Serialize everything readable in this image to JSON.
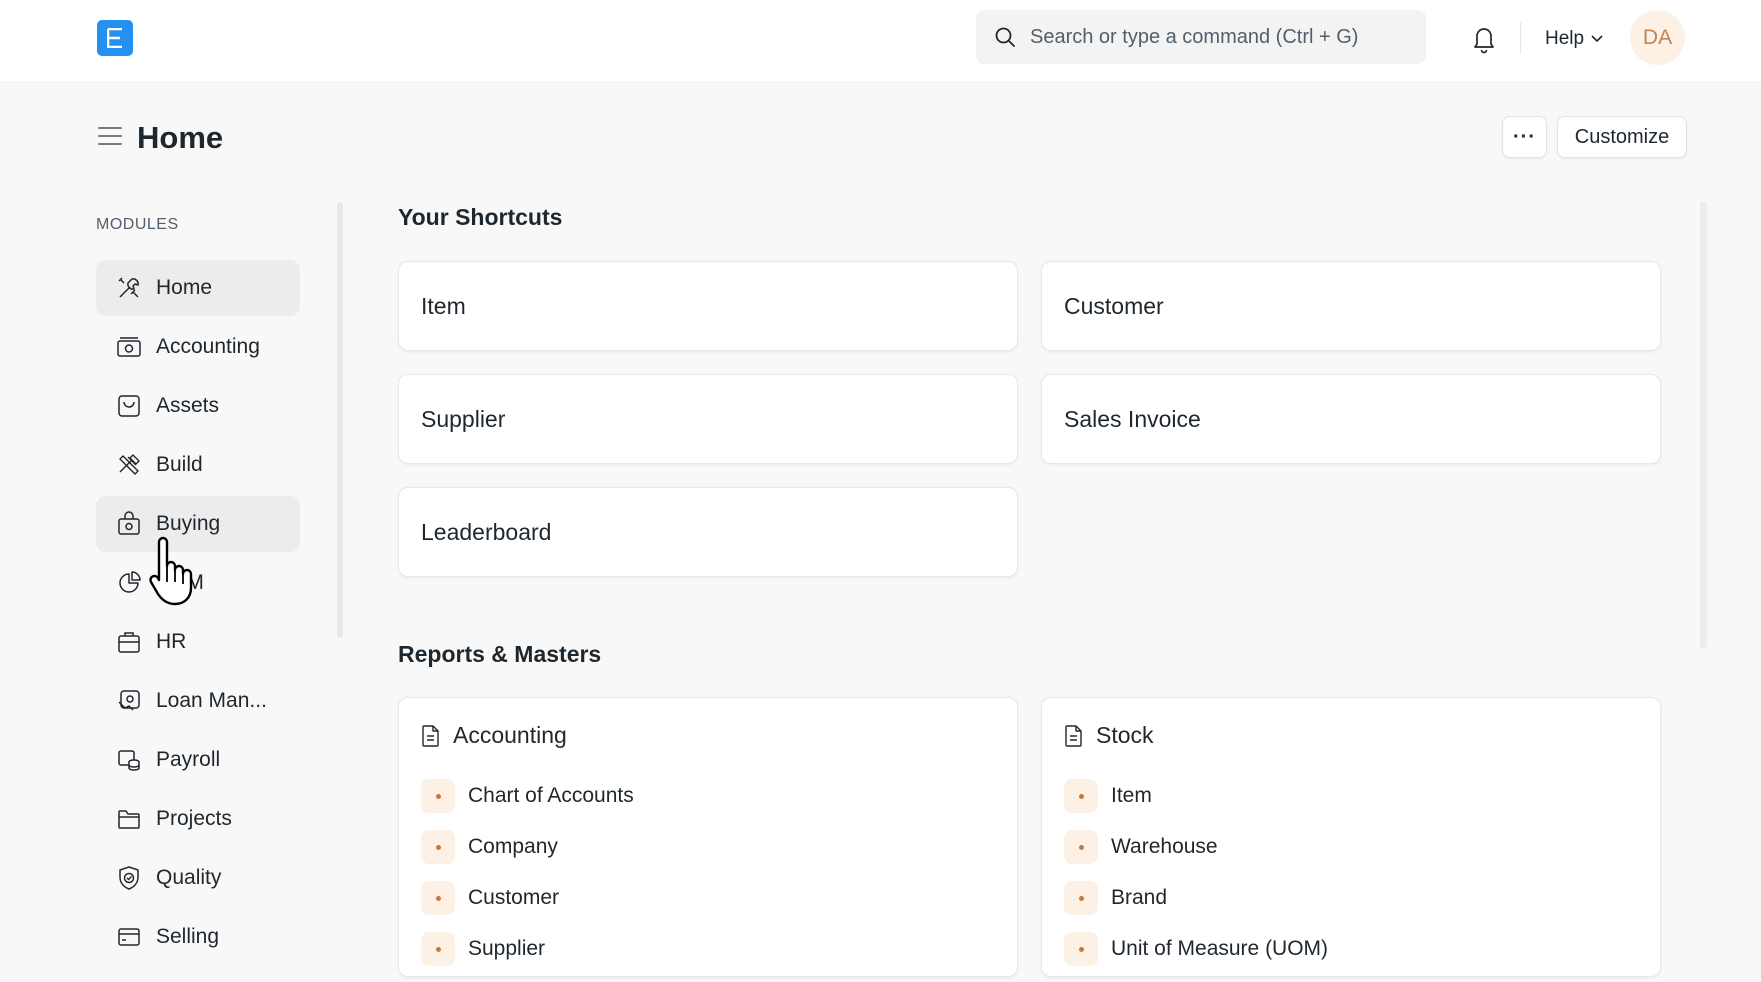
{
  "navbar": {
    "logo_letter": "E",
    "search_placeholder": "Search or type a command (Ctrl + G)",
    "help_label": "Help",
    "avatar_initials": "DA"
  },
  "page": {
    "title": "Home",
    "more_label": "···",
    "customize_label": "Customize"
  },
  "sidebar": {
    "heading": "MODULES",
    "items": [
      {
        "label": "Home",
        "icon": "tools-icon"
      },
      {
        "label": "Accounting",
        "icon": "money-icon"
      },
      {
        "label": "Assets",
        "icon": "assets-icon"
      },
      {
        "label": "Build",
        "icon": "build-icon"
      },
      {
        "label": "Buying",
        "icon": "buying-icon"
      },
      {
        "label": "CRM",
        "icon": "crm-icon"
      },
      {
        "label": "HR",
        "icon": "hr-icon"
      },
      {
        "label": "Loan Man...",
        "icon": "loan-icon"
      },
      {
        "label": "Payroll",
        "icon": "payroll-icon"
      },
      {
        "label": "Projects",
        "icon": "folder-icon"
      },
      {
        "label": "Quality",
        "icon": "quality-icon"
      },
      {
        "label": "Selling",
        "icon": "selling-icon"
      }
    ]
  },
  "shortcuts": {
    "title": "Your Shortcuts",
    "items": [
      "Item",
      "Customer",
      "Supplier",
      "Sales Invoice",
      "Leaderboard"
    ]
  },
  "reports": {
    "title": "Reports & Masters",
    "cards": [
      {
        "title": "Accounting",
        "links": [
          "Chart of Accounts",
          "Company",
          "Customer",
          "Supplier"
        ]
      },
      {
        "title": "Stock",
        "links": [
          "Item",
          "Warehouse",
          "Brand",
          "Unit of Measure (UOM)"
        ]
      }
    ]
  },
  "colors": {
    "brand": "#2490ef",
    "active_bg": "#ececec",
    "bullet_bg": "#fcf1e4",
    "bullet_dot": "#c8783a"
  }
}
